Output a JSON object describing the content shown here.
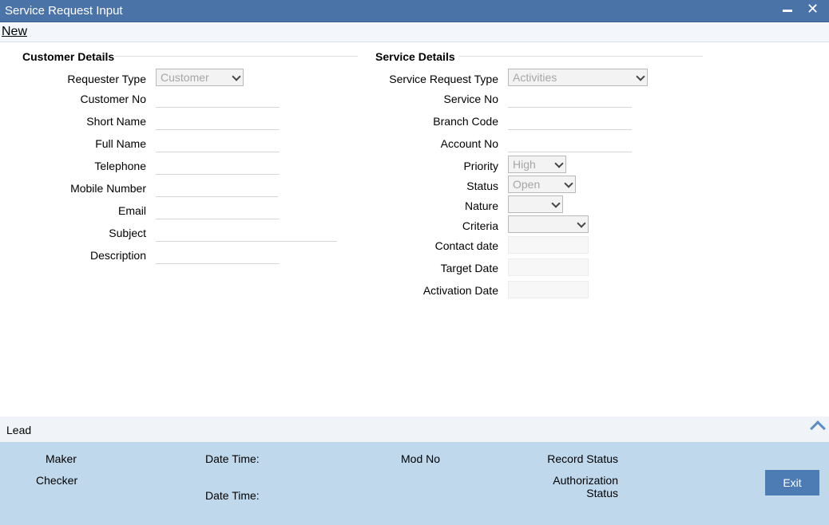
{
  "window": {
    "title": "Service Request Input"
  },
  "toolbar": {
    "new_label": "New"
  },
  "customer": {
    "title": "Customer Details",
    "requester_type_label": "Requester Type",
    "requester_type_value": "Customer",
    "customer_no_label": "Customer No",
    "short_name_label": "Short Name",
    "full_name_label": "Full Name",
    "telephone_label": "Telephone",
    "mobile_label": "Mobile Number",
    "email_label": "Email",
    "subject_label": "Subject",
    "description_label": "Description"
  },
  "service": {
    "title": "Service Details",
    "request_type_label": "Service Request Type",
    "request_type_value": "Activities",
    "service_no_label": "Service No",
    "branch_code_label": "Branch Code",
    "account_no_label": "Account No",
    "priority_label": "Priority",
    "priority_value": "High",
    "status_label": "Status",
    "status_value": "Open",
    "nature_label": "Nature",
    "criteria_label": "Criteria",
    "contact_date_label": "Contact date",
    "target_date_label": "Target Date",
    "activation_date_label": "Activation Date"
  },
  "lead": {
    "label": "Lead"
  },
  "footer": {
    "maker": "Maker",
    "checker": "Checker",
    "date_time_1": "Date Time:",
    "date_time_2": "Date Time:",
    "mod_no": "Mod No",
    "record_status": "Record Status",
    "auth_status_line1": "Authorization",
    "auth_status_line2": "Status",
    "exit_label": "Exit"
  }
}
